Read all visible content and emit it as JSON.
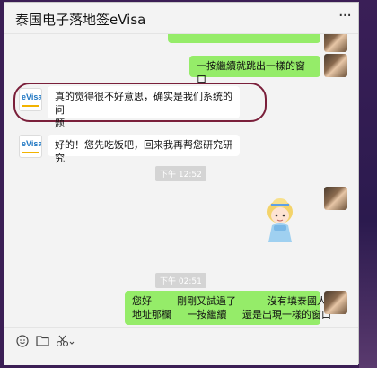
{
  "window": {
    "title": "泰国电子落地签eVisa",
    "more_icon": "more-icon"
  },
  "messages": [
    {
      "side": "out",
      "text": "",
      "partial": true
    },
    {
      "side": "out",
      "text": "一按繼續就跳出一樣的窗口"
    },
    {
      "side": "in",
      "text_line1": "真的觉得很不好意思，确实是我们系统的问",
      "text_line2": "题",
      "highlighted": true
    },
    {
      "side": "in",
      "text": "好的！您先吃饭吧，回来我再帮您研究研究"
    },
    {
      "type": "timestamp",
      "text": "下午 12:52"
    },
    {
      "side": "out",
      "type": "sticker",
      "sticker_icon": "cinderella-sticker"
    },
    {
      "type": "timestamp",
      "text": "下午 02:51"
    },
    {
      "side": "out",
      "text_line1": "您好        剛剛又試過了          沒有填泰國人員",
      "text_line2": "地址那欄     一按繼續     還是出現一樣的窗口"
    }
  ],
  "avatars": {
    "evisa_label": "eVisa"
  },
  "toolbar": {
    "emoji_icon": "emoji-icon",
    "folder_icon": "folder-icon",
    "scissors_icon": "scissors-icon",
    "chevron_icon": "chevron-down-icon"
  },
  "colors": {
    "out_bubble": "#95ec69",
    "in_bubble": "#ffffff",
    "highlight": "#7a1f3a"
  }
}
